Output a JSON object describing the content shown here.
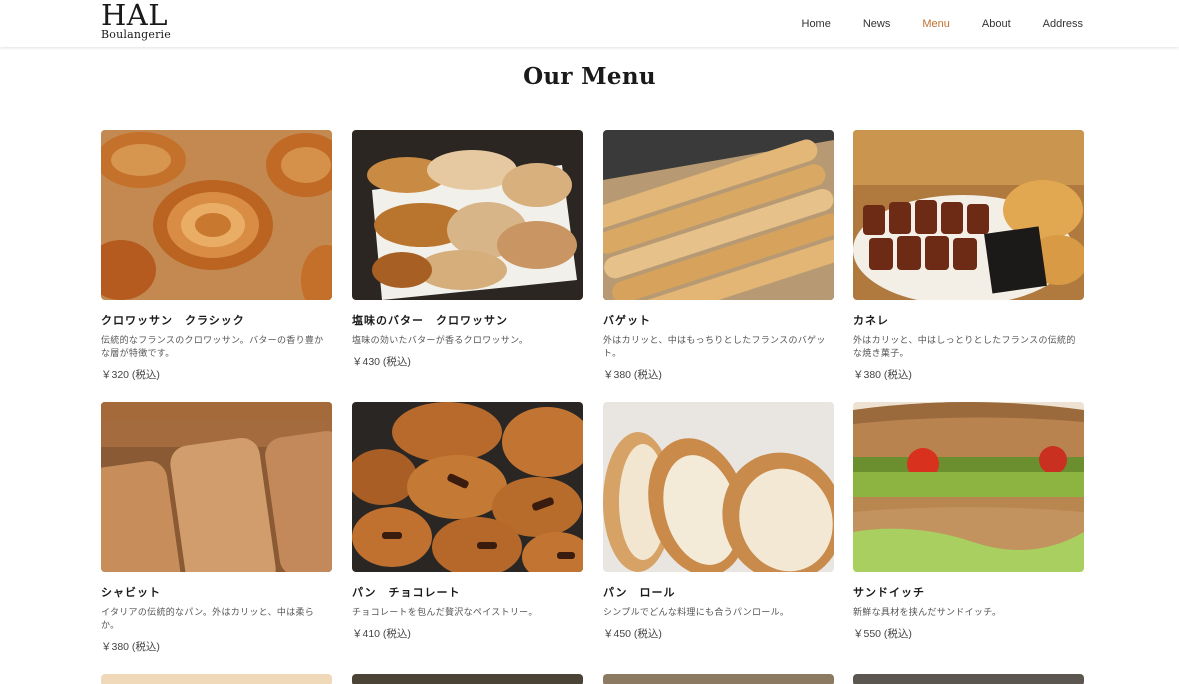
{
  "brand": {
    "name": "HAL",
    "sub": "Boulangerie"
  },
  "nav": [
    {
      "label": "Home",
      "active": false
    },
    {
      "label": "News",
      "active": false
    },
    {
      "label": "Menu",
      "active": true
    },
    {
      "label": "About",
      "active": false
    },
    {
      "label": "Address",
      "active": false
    }
  ],
  "colors": {
    "accent": "#c0702f"
  },
  "page_title": "Our Menu",
  "items": [
    {
      "name": "クロワッサン　クラシック",
      "desc": "伝統的なフランスのクロワッサン。バターの香り豊かな層が特徴です。",
      "price": "￥320 (税込)"
    },
    {
      "name": "塩味のバター　クロワッサン",
      "desc": "塩味の効いたバターが香るクロワッサン。",
      "price": "￥430 (税込)"
    },
    {
      "name": "バゲット",
      "desc": "外はカリッと、中はもっちりとしたフランスのバゲット。",
      "price": "￥380 (税込)"
    },
    {
      "name": "カネレ",
      "desc": "外はカリッと、中はしっとりとしたフランスの伝統的な焼き菓子。",
      "price": "￥380 (税込)"
    },
    {
      "name": "シャビット",
      "desc": "イタリアの伝統的なパン。外はカリッと、中は柔らか。",
      "price": "￥380 (税込)"
    },
    {
      "name": "パン　チョコレート",
      "desc": "チョコレートを包んだ贅沢なペイストリー。",
      "price": "￥410 (税込)"
    },
    {
      "name": "パン　ロール",
      "desc": "シンプルでどんな料理にも合うパンロール。",
      "price": "￥450 (税込)"
    },
    {
      "name": "サンドイッチ",
      "desc": "新鮮な具材を挟んだサンドイッチ。",
      "price": "￥550 (税込)"
    }
  ]
}
